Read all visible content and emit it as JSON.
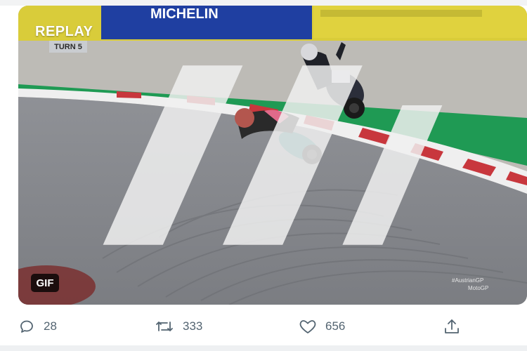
{
  "media": {
    "replay_label": "REPLAY",
    "turn_label": "TURN 5",
    "gif_label": "GIF",
    "banner_text": "MICHELIN",
    "hashtag": "#AustrianGP",
    "league": "MotoGP"
  },
  "actions": {
    "reply_count": "28",
    "retweet_count": "333",
    "like_count": "656"
  },
  "colors": {
    "accent_green": "#1f9a54",
    "banner_blue": "#1f3fa1",
    "banner_yellow": "#e0d23e",
    "icon_gray": "#536471"
  }
}
